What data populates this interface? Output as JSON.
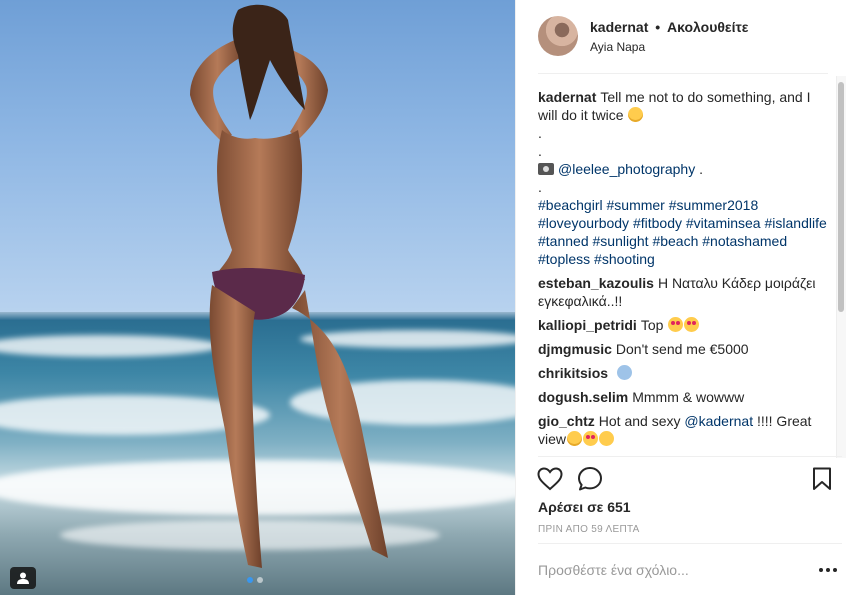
{
  "header": {
    "username": "kadernat",
    "separator": "•",
    "follow_status": "Ακολουθείτε",
    "location": "Ayia Napa"
  },
  "caption": {
    "username": "kadernat",
    "text": "Tell me not to do something, and I will do it twice",
    "dot1": ".",
    "dot2": ".",
    "photo_credit": "@leelee_photography",
    "photo_credit_suffix": " .",
    "dot3": ".",
    "hashtags": [
      "#beachgirl",
      "#summer",
      "#summer2018",
      "#loveyourbody",
      "#fitbody",
      "#vitaminsea",
      "#islandlife",
      "#tanned",
      "#sunlight",
      "#beach",
      "#notashamed",
      "#topless",
      "#shooting"
    ]
  },
  "comments": [
    {
      "username": "esteban_kazoulis",
      "text": "Η Ναταλυ Κάδερ μοιράζει εγκεφαλικά..!!",
      "emoji": ""
    },
    {
      "username": "kalliopi_petridi",
      "text": "Top",
      "emoji": "love love"
    },
    {
      "username": "djmgmusic",
      "text": "Don't send me €5000",
      "emoji": ""
    },
    {
      "username": "chrikitsios",
      "text": "",
      "emoji": "shock"
    },
    {
      "username": "dogush.selim",
      "text": "Mmmm & wowww",
      "emoji": ""
    },
    {
      "username": "gio_chtz",
      "text": "Hot and sexy",
      "mention": "@kadernat",
      "after_mention": " !!!! Great view",
      "emoji": "wink love kiss"
    }
  ],
  "stats": {
    "likes": "Αρέσει σε 651",
    "timestamp": "ΠΡΙΝ ΑΠΟ 59 ΛΕΠΤΑ"
  },
  "add_comment": {
    "placeholder": "Προσθέστε ένα σχόλιο..."
  },
  "icons": {
    "like": "heart-icon",
    "comment": "comment-bubble-icon",
    "save": "bookmark-icon",
    "more": "more-options-icon",
    "multi": "user-tag-icon"
  },
  "carousel": {
    "count": 2,
    "active": 1
  },
  "colors": {
    "link": "#003569",
    "muted": "#999999",
    "active_dot": "#3897f0",
    "text": "#262626"
  }
}
